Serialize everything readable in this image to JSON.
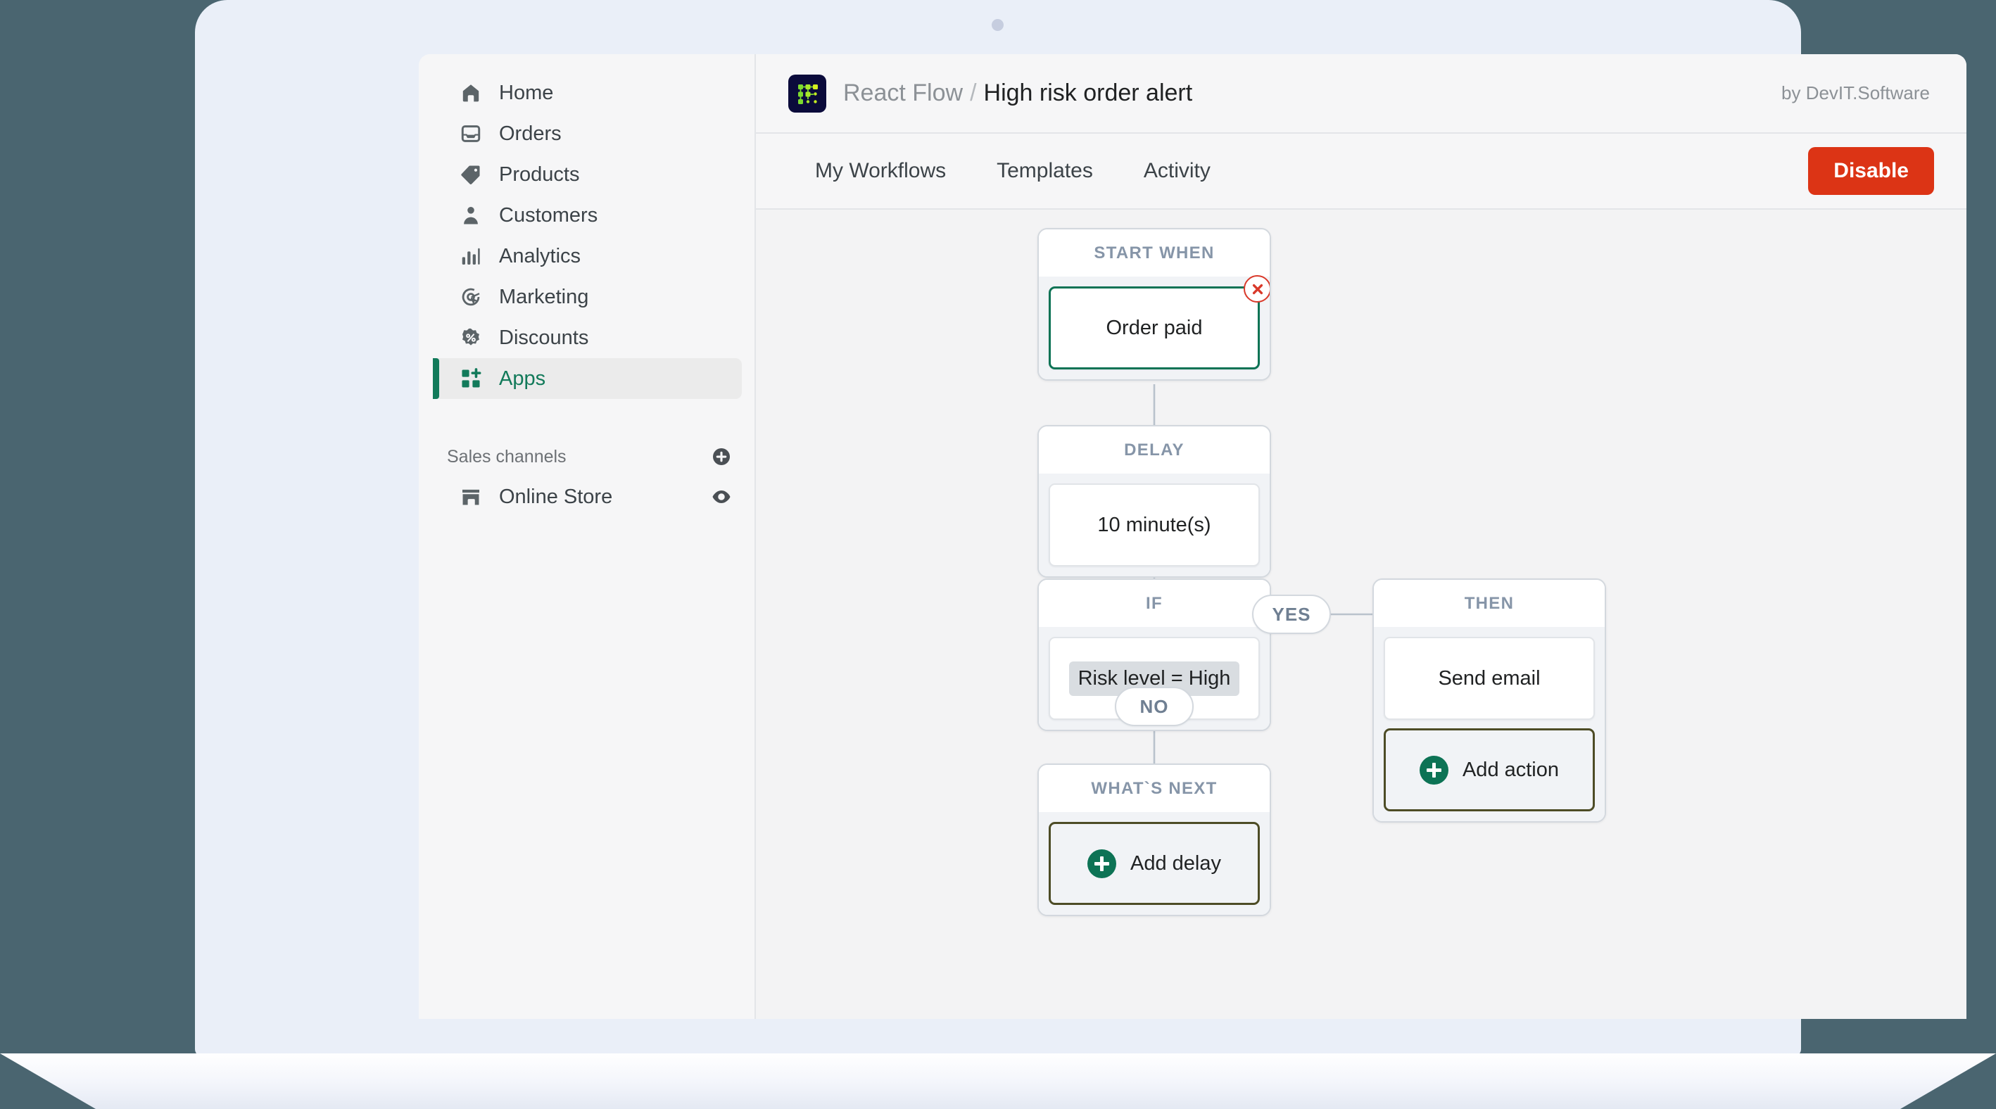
{
  "app": {
    "vendor": "by DevIT.Software",
    "logo_icon": "react-flow-node-graph-icon",
    "breadcrumb_root": "React Flow",
    "breadcrumb_separator": "/",
    "breadcrumb_current": "High risk order alert"
  },
  "sidebar": {
    "items": [
      {
        "label": "Home",
        "icon": "home-icon",
        "active": false
      },
      {
        "label": "Orders",
        "icon": "orders-inbox-icon",
        "active": false
      },
      {
        "label": "Products",
        "icon": "product-tag-icon",
        "active": false
      },
      {
        "label": "Customers",
        "icon": "customer-person-icon",
        "active": false
      },
      {
        "label": "Analytics",
        "icon": "analytics-bars-icon",
        "active": false
      },
      {
        "label": "Marketing",
        "icon": "marketing-target-icon",
        "active": false
      },
      {
        "label": "Discounts",
        "icon": "discount-percent-icon",
        "active": false
      },
      {
        "label": "Apps",
        "icon": "apps-grid-plus-icon",
        "active": true
      }
    ],
    "section": {
      "title": "Sales channels",
      "add_icon": "plus-circle-icon"
    },
    "channels": [
      {
        "label": "Online Store",
        "icon": "storefront-icon",
        "action_icon": "eye-icon"
      }
    ]
  },
  "tabs": [
    {
      "label": "My Workflows",
      "active": false
    },
    {
      "label": "Templates",
      "active": false
    },
    {
      "label": "Activity",
      "active": false
    }
  ],
  "actions": {
    "disable_label": "Disable"
  },
  "workflow": {
    "nodes": [
      {
        "id": "start",
        "title": "START WHEN",
        "cards": [
          {
            "label": "Order paid",
            "selected": true,
            "close_icon": "close-circle-icon"
          }
        ]
      },
      {
        "id": "delay",
        "title": "DELAY",
        "cards": [
          {
            "label": "10 minute(s)",
            "selected": false
          }
        ]
      },
      {
        "id": "if",
        "title": "IF",
        "cards": [
          {
            "label": "Risk level = High",
            "chip": true
          }
        ]
      },
      {
        "id": "then",
        "title": "THEN",
        "cards": [
          {
            "label": "Send email",
            "selected": false
          }
        ],
        "add_button": {
          "label": "Add action",
          "icon": "plus-circle-icon"
        }
      },
      {
        "id": "whats_next",
        "title": "WHAT`S NEXT",
        "add_button": {
          "label": "Add delay",
          "icon": "plus-circle-icon"
        }
      }
    ],
    "branch_labels": [
      {
        "id": "yes",
        "label": "YES"
      },
      {
        "id": "no",
        "label": "NO"
      }
    ]
  },
  "colors": {
    "accent_green": "#0d7355",
    "danger_red": "#dc3415",
    "close_red": "#d9392a",
    "canvas_bg": "#f3f3f4",
    "desk_bg": "#4a6570",
    "node_header_text": "#8695a8"
  }
}
